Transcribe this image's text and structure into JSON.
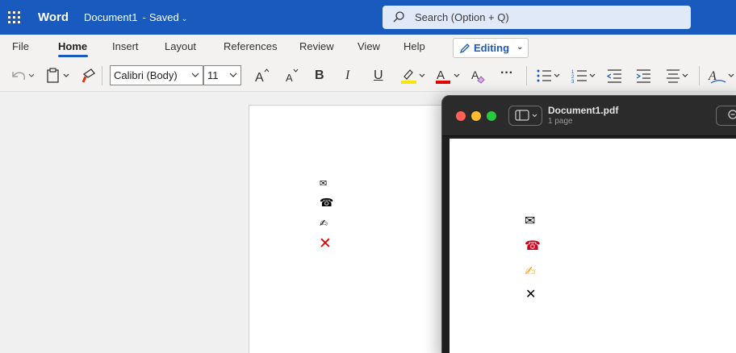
{
  "titlebar": {
    "app_name": "Word",
    "doc_name": "Document1",
    "separator": "-",
    "save_status": "Saved",
    "search_placeholder": "Search (Option + Q)"
  },
  "ribbon": {
    "tabs": [
      {
        "label": "File"
      },
      {
        "label": "Home",
        "active": true
      },
      {
        "label": "Insert"
      },
      {
        "label": "Layout"
      },
      {
        "label": "References"
      },
      {
        "label": "Review"
      },
      {
        "label": "View"
      },
      {
        "label": "Help"
      }
    ],
    "mode_label": "Editing"
  },
  "toolbar": {
    "font_name": "Calibri (Body)",
    "font_size": "11",
    "bold": "B",
    "italic": "I",
    "underline": "U",
    "more": "···",
    "highlight_color": "#f7e600",
    "font_color": "#e00000"
  },
  "document": {
    "symbols": [
      {
        "name": "envelope",
        "glyph": "✉"
      },
      {
        "name": "telephone",
        "glyph": "☎"
      },
      {
        "name": "writing-hand",
        "glyph": "✍"
      },
      {
        "name": "cross-mark",
        "glyph": "❌",
        "color": "#e00000"
      }
    ]
  },
  "pdf_viewer": {
    "file_name": "Document1.pdf",
    "page_count": "1 page",
    "symbols": [
      {
        "name": "envelope",
        "glyph": "✉"
      },
      {
        "name": "telephone",
        "glyph": "☎",
        "color": "#d0021b"
      },
      {
        "name": "writing-hand",
        "glyph": "✍",
        "color": "#f5a623"
      },
      {
        "name": "cross-mark",
        "glyph": "✕"
      }
    ]
  },
  "colors": {
    "brand": "#185abd",
    "titlebar_text": "#ffffff",
    "traffic_red": "#ff5f57",
    "traffic_yellow": "#febc2e",
    "traffic_green": "#28c840"
  }
}
